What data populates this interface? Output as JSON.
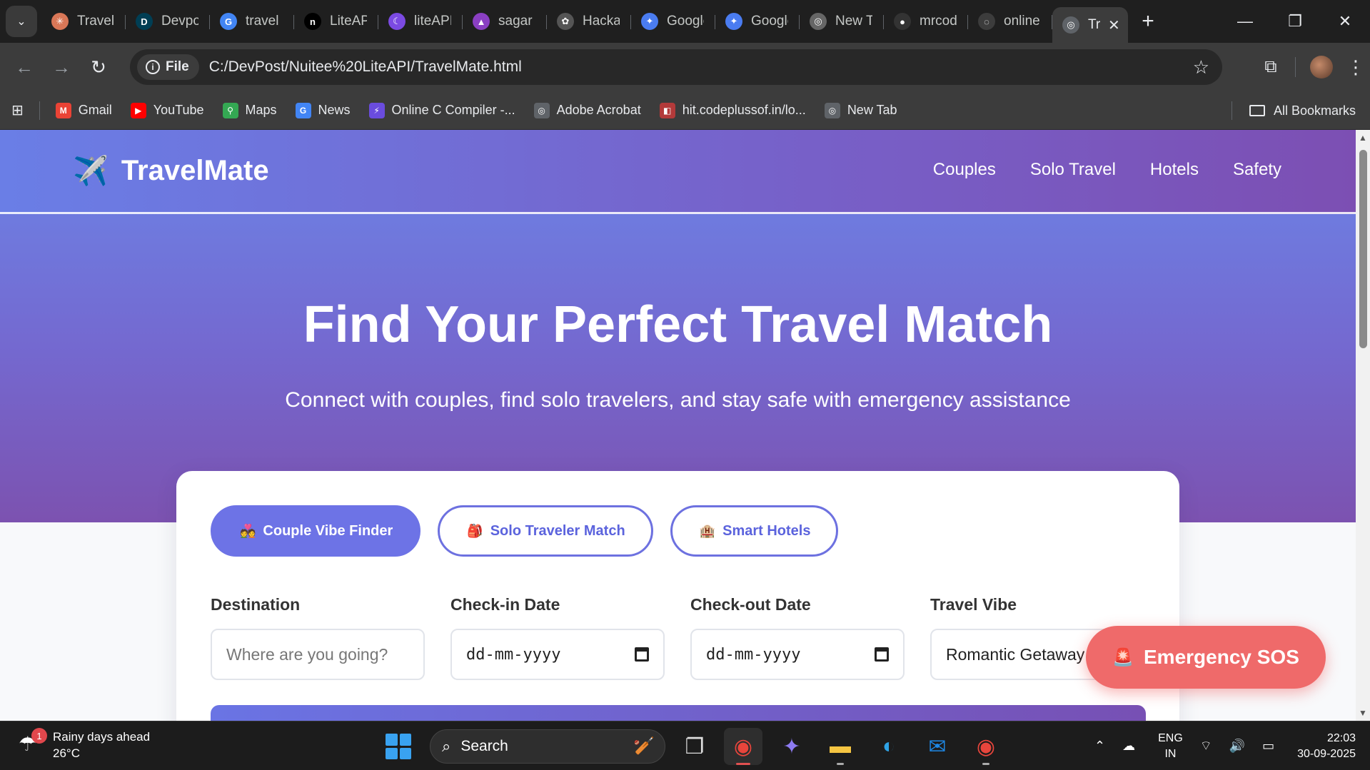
{
  "browser": {
    "tabs": [
      {
        "title": "Travel",
        "icon": "claude-icon",
        "color": "#d97757"
      },
      {
        "title": "Devpost",
        "icon": "devpost-icon",
        "color": "#003e54"
      },
      {
        "title": "travel",
        "icon": "google-icon",
        "color": "#4285f4"
      },
      {
        "title": "LiteAPI",
        "icon": "notion-icon",
        "color": "#000000"
      },
      {
        "title": "liteAPI",
        "icon": "moon-icon",
        "color": "#7b4ae2"
      },
      {
        "title": "sagar",
        "icon": "vercel-icon",
        "color": "#8a3fc2"
      },
      {
        "title": "Hackathon",
        "icon": "openai-icon",
        "color": "#555555"
      },
      {
        "title": "Google",
        "icon": "gemini-icon",
        "color": "#4a7cf0"
      },
      {
        "title": "Google",
        "icon": "gemini-icon",
        "color": "#4a7cf0"
      },
      {
        "title": "New Tab",
        "icon": "chrome-icon",
        "color": "#666666"
      },
      {
        "title": "mrcoder",
        "icon": "github-icon",
        "color": "#333333"
      },
      {
        "title": "online",
        "icon": "loading-icon",
        "color": "#3c3c3c"
      }
    ],
    "active_tab": {
      "title": "Tr",
      "icon": "globe-icon"
    },
    "address": {
      "chip": "File",
      "url": "C:/DevPost/Nuitee%20LiteAPI/TravelMate.html"
    },
    "bookmarks": [
      {
        "label": "Gmail",
        "icon": "gmail-icon",
        "color": "#ea4335"
      },
      {
        "label": "YouTube",
        "icon": "youtube-icon",
        "color": "#ff0000"
      },
      {
        "label": "Maps",
        "icon": "maps-icon",
        "color": "#34a853"
      },
      {
        "label": "News",
        "icon": "news-icon",
        "color": "#4285f4"
      },
      {
        "label": "Online C Compiler -...",
        "icon": "bolt-icon",
        "color": "#6a4cde"
      },
      {
        "label": "Adobe Acrobat",
        "icon": "globe-icon",
        "color": "#5f6368"
      },
      {
        "label": "hit.codeplussof.in/lo...",
        "icon": "code-icon",
        "color": "#b33a3a"
      },
      {
        "label": "New Tab",
        "icon": "globe-icon",
        "color": "#5f6368"
      }
    ],
    "all_bookmarks": "All Bookmarks"
  },
  "site": {
    "logo": "TravelMate",
    "logo_icon": "airplane-icon",
    "nav": [
      "Couples",
      "Solo Travel",
      "Hotels",
      "Safety"
    ],
    "hero_title": "Find Your Perfect Travel Match",
    "hero_subtitle": "Connect with couples, find solo travelers, and stay safe with emergency assistance",
    "feature_tabs": [
      {
        "label": "Couple Vibe Finder",
        "emoji": "💑",
        "active": true
      },
      {
        "label": "Solo Traveler Match",
        "emoji": "🎒",
        "active": false
      },
      {
        "label": "Smart Hotels",
        "emoji": "🏨",
        "active": false
      }
    ],
    "form": {
      "destination": {
        "label": "Destination",
        "placeholder": "Where are you going?"
      },
      "checkin": {
        "label": "Check-in Date",
        "value": "dd-mm-yyyy"
      },
      "checkout": {
        "label": "Check-out Date",
        "value": "dd-mm-yyyy"
      },
      "vibe": {
        "label": "Travel Vibe",
        "value": "Romantic Getaway"
      }
    },
    "sos": {
      "label": "Emergency SOS",
      "emoji": "🚨"
    }
  },
  "taskbar": {
    "weather": {
      "text": "Rainy days ahead",
      "temp": "26°C",
      "badge": "1"
    },
    "search": "Search",
    "tray": {
      "lang1": "ENG",
      "lang2": "IN",
      "time": "22:03",
      "date": "30-09-2025"
    }
  },
  "colors": {
    "brand_start": "#6a7ee6",
    "brand_end": "#7c4fb3",
    "accent": "#6d73e6",
    "sos": "#ef6a6a"
  }
}
